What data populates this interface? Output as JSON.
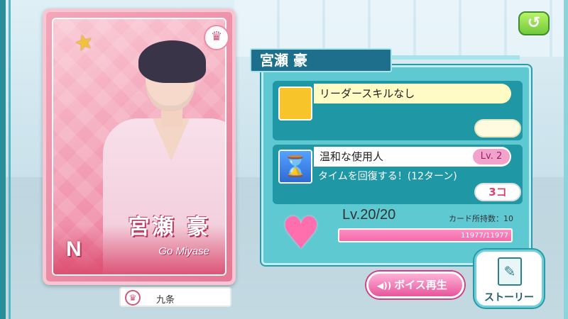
{
  "card": {
    "rarity": "N",
    "name_jp": "宮瀬 豪",
    "name_en": "Go Miyase",
    "school": "九条"
  },
  "panel": {
    "title": "宮瀬 豪"
  },
  "leader_skill": {
    "label": "リーダースキルなし"
  },
  "skill": {
    "name": "温和な使用人",
    "level": "Lv. 2",
    "description": "タイムを回復する！(12ターン)",
    "count": "3コ",
    "icon": "hourglass-arrow-icon"
  },
  "status": {
    "level": "Lv.20/20",
    "card_count": "カード所持数：10",
    "exp": "11977/11977",
    "exp_fraction": 1.0
  },
  "buttons": {
    "voice": "ボイス再生",
    "story": "ストーリー"
  }
}
